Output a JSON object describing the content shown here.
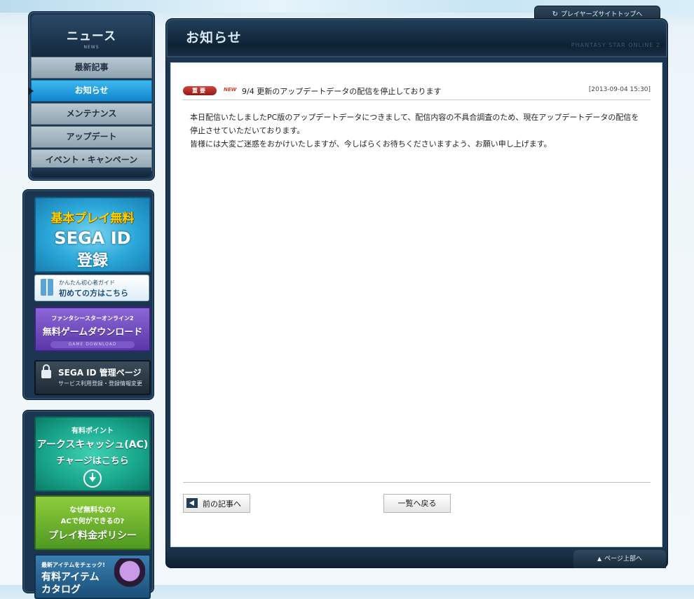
{
  "sidebar": {
    "title": "ニュース",
    "subtitle": "NEWS",
    "items": [
      {
        "label": "最新記事"
      },
      {
        "label": "お知らせ"
      },
      {
        "label": "メンテナンス"
      },
      {
        "label": "アップデート"
      },
      {
        "label": "イベント・キャンペーン"
      }
    ],
    "active_index": 1
  },
  "promos": {
    "sega_register": {
      "line1": "基本プレイ無料",
      "line2": "SEGA ID",
      "line3": "登録"
    },
    "beginner_guide": {
      "small": "かんたん初心者ガイド",
      "main": "初めての方はこちら"
    },
    "free_download": {
      "small": "ファンタシースターオンライン2",
      "main": "無料ゲームダウンロード",
      "ribbon": "GAME DOWNLOAD"
    },
    "sega_id_manage": {
      "main": "SEGA ID 管理ページ",
      "sub": "サービス利用登録・登録情報変更"
    },
    "arks_cash": {
      "line1": "有料ポイント",
      "line2": "アークスキャッシュ(AC)",
      "line3": "チャージはこちら"
    },
    "play_policy": {
      "line1": "なぜ無料なの?",
      "line2": "ACで何ができるの?",
      "line3": "プレイ料金ポリシー"
    },
    "catalog": {
      "small": "最新アイテムをチェック!",
      "line1": "有料アイテム",
      "line2": "カタログ"
    }
  },
  "header": {
    "players_site_link": "プレイヤーズサイトトップへ",
    "page_title": "お知らせ",
    "deco_text": "PHANTASY STAR ONLINE 2"
  },
  "article": {
    "badge": "重要",
    "new_label": "NEW",
    "title": "9/4 更新のアップデートデータの配信を停止しております",
    "date": "[2013-09-04 15:30]",
    "body": [
      "本日配信いたしましたPC版のアップデートデータにつきまして、配信内容の不具合調査のため、現在アップデートデータの配信を停止させていただいております。",
      "皆様には大変ご迷惑をおかけいたしますが、今しばらくお待ちくださいますよう、お願い申し上げます。"
    ]
  },
  "footer_nav": {
    "prev_label": "前の記事へ",
    "list_label": "一覧へ戻る",
    "page_top": "ページ上部へ"
  },
  "colors": {
    "accent_active": "#1a95dd",
    "badge_red": "#b2302b",
    "frame_dark": "#1c3550"
  }
}
